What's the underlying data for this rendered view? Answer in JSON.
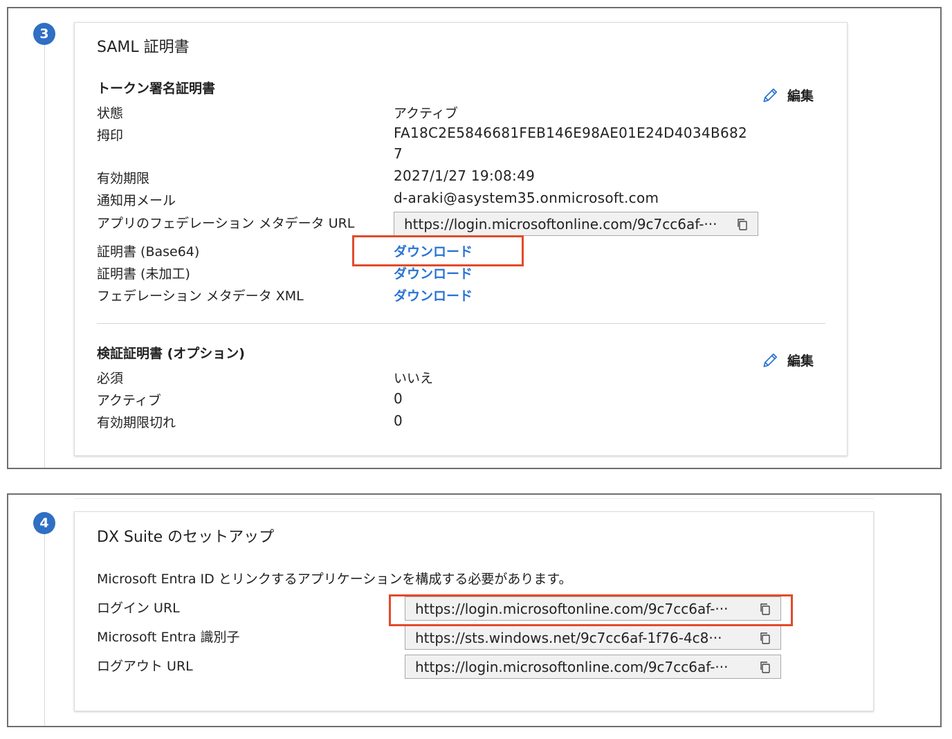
{
  "panel3": {
    "step": "3",
    "title": "SAML 証明書",
    "token_section": {
      "heading": "トークン署名証明書",
      "edit_label": "編集",
      "rows": {
        "status": {
          "label": "状態",
          "value": "アクティブ"
        },
        "thumbprint": {
          "label": "拇印",
          "value_line1": "FA18C2E5846681FEB146E98AE01E24D4034B682",
          "value_line2": "7"
        },
        "expiry": {
          "label": "有効期限",
          "value": "2027/1/27 19:08:49"
        },
        "notify_email": {
          "label": "通知用メール",
          "value": "d-araki@asystem35.onmicrosoft.com"
        },
        "metadata_url": {
          "label": "アプリのフェデレーション メタデータ URL",
          "value": "https://login.microsoftonline.com/9c7cc6af-···"
        },
        "cert_base64": {
          "label": "証明書 (Base64)",
          "link": "ダウンロード"
        },
        "cert_raw": {
          "label": "証明書 (未加工)",
          "link": "ダウンロード"
        },
        "metadata_xml": {
          "label": "フェデレーション メタデータ XML",
          "link": "ダウンロード"
        }
      }
    },
    "verify_section": {
      "heading": "検証証明書 (オプション)",
      "edit_label": "編集",
      "rows": {
        "required": {
          "label": "必須",
          "value": "いいえ"
        },
        "active": {
          "label": "アクティブ",
          "value": "0"
        },
        "expired": {
          "label": "有効期限切れ",
          "value": "0"
        }
      }
    }
  },
  "panel4": {
    "step": "4",
    "title": "DX Suite のセットアップ",
    "description": "Microsoft Entra ID とリンクするアプリケーションを構成する必要があります。",
    "rows": {
      "login_url": {
        "label": "ログイン URL",
        "value": "https://login.microsoftonline.com/9c7cc6af-···"
      },
      "entra_id": {
        "label": "Microsoft Entra 識別子",
        "value": "https://sts.windows.net/9c7cc6af-1f76-4c8···"
      },
      "logout_url": {
        "label": "ログアウト URL",
        "value": "https://login.microsoftonline.com/9c7cc6af-···"
      }
    }
  },
  "colors": {
    "badge": "#2f6fc4",
    "link": "#2a74d4",
    "highlight": "#e34a2b",
    "frame": "#6e6e6e"
  },
  "icons": [
    "pencil-icon",
    "copy-icon"
  ]
}
